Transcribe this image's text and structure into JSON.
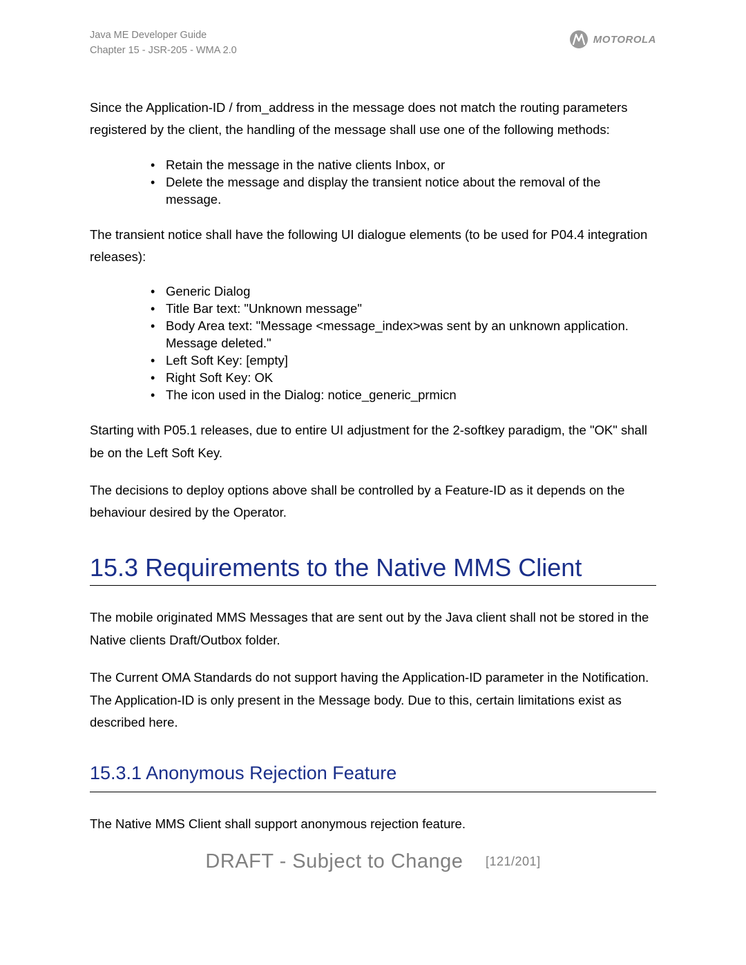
{
  "header": {
    "line1": "Java ME Developer Guide",
    "line2": "Chapter 15 - JSR-205 - WMA 2.0",
    "brand": "MOTOROLA"
  },
  "content": {
    "p1": "Since the Application-ID / from_address in the message does not match the routing parameters registered by the client, the handling of the message shall use one of the following methods:",
    "list1": [
      "Retain the message in the native clients Inbox, or",
      "Delete the message and display the transient notice about the removal of the message."
    ],
    "p2": "The transient notice shall have the following UI dialogue elements (to be used for P04.4 integration releases):",
    "list2": [
      "Generic Dialog",
      "Title Bar text: \"Unknown message\"",
      "Body Area text: \"Message <message_index>was sent by an unknown application. Message deleted.\"",
      "Left Soft Key: [empty]",
      "Right Soft Key: OK",
      "The icon used in the Dialog: notice_generic_prmicn"
    ],
    "p3": "Starting with P05.1 releases, due to entire UI adjustment for the 2-softkey paradigm, the \"OK\" shall be on the Left Soft Key.",
    "p4": "The decisions to deploy options above shall be controlled by a Feature-ID as it depends on the behaviour desired by the Operator.",
    "h2": "15.3 Requirements to the Native MMS Client",
    "p5": "The mobile originated MMS Messages that are sent out by the Java client shall not be stored in the Native clients Draft/Outbox folder.",
    "p6": "The Current OMA Standards do not support having the Application-ID parameter in the Notification. The Application-ID is only present in the Message body. Due to this, certain limitations exist as described here.",
    "h3": "15.3.1 Anonymous Rejection Feature",
    "p7": "The Native MMS Client shall support anonymous rejection feature."
  },
  "footer": {
    "watermark": "DRAFT - Subject to Change",
    "page": "[121/201]"
  }
}
